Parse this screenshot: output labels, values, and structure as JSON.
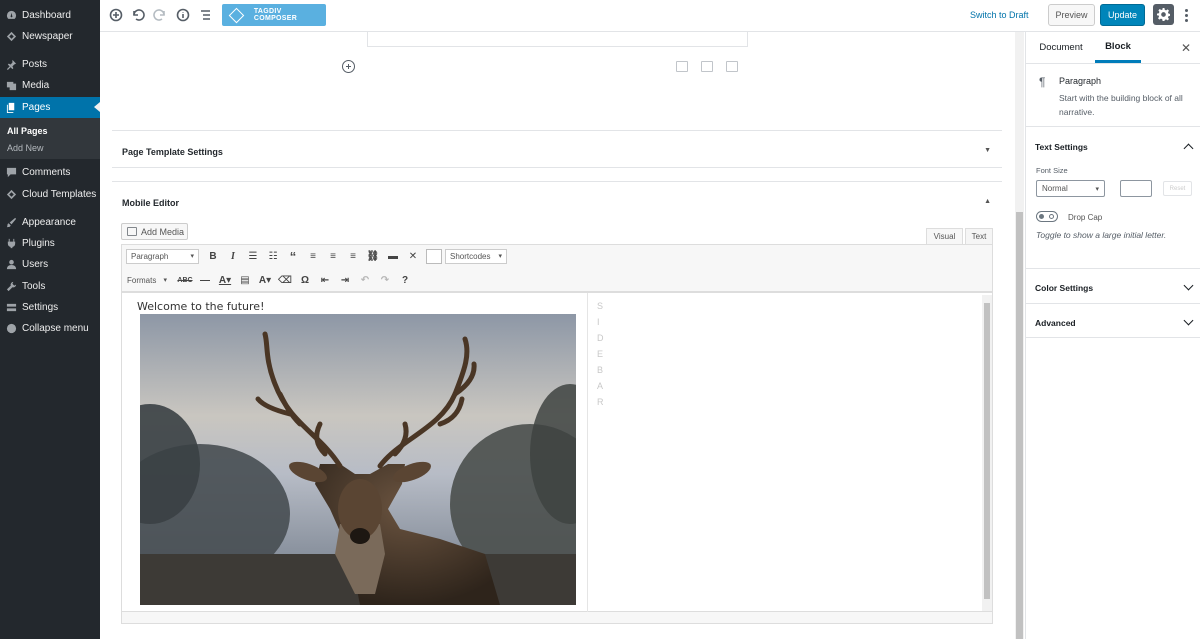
{
  "admin_menu": {
    "items": [
      {
        "label": "Dashboard",
        "icon": "dashboard-icon"
      },
      {
        "label": "Newspaper",
        "icon": "newspaper-icon"
      },
      {
        "label": "Posts",
        "icon": "pin-icon"
      },
      {
        "label": "Media",
        "icon": "media-icon"
      },
      {
        "label": "Pages",
        "icon": "pages-icon",
        "active": true
      },
      {
        "label": "Comments",
        "icon": "comments-icon"
      },
      {
        "label": "Cloud Templates",
        "icon": "cloud-icon"
      },
      {
        "label": "Appearance",
        "icon": "brush-icon"
      },
      {
        "label": "Plugins",
        "icon": "plugin-icon"
      },
      {
        "label": "Users",
        "icon": "users-icon"
      },
      {
        "label": "Tools",
        "icon": "wrench-icon"
      },
      {
        "label": "Settings",
        "icon": "settings-icon"
      },
      {
        "label": "Collapse menu",
        "icon": "collapse-icon"
      }
    ],
    "submenu": {
      "current": "All Pages",
      "other": "Add New"
    }
  },
  "topbar": {
    "tagdiv_label": "TAGDIV COMPOSER",
    "switch_draft": "Switch to Draft",
    "preview": "Preview",
    "update": "Update"
  },
  "content": {
    "page_template_title": "Page Template Settings",
    "page_template_toggle": "▼",
    "mobile_editor_title": "Mobile Editor",
    "mobile_editor_toggle": "▲",
    "add_media": "Add Media",
    "tab_visual": "Visual",
    "tab_text": "Text",
    "format_select": "Paragraph",
    "shortcodes_select": "Shortcodes",
    "formats_select": "Formats",
    "welcome_text": "Welcome to the future!",
    "sidebar_letters": [
      "S",
      "I",
      "D",
      "E",
      "B",
      "A",
      "R"
    ]
  },
  "settings_panel": {
    "tab_document": "Document",
    "tab_block": "Block",
    "close": "✕",
    "block_icon": "¶",
    "block_name": "Paragraph",
    "block_desc": "Start with the building block of all narrative.",
    "text_settings": "Text Settings",
    "font_size_label": "Font Size",
    "font_size_value": "Normal",
    "reset": "Reset",
    "drop_cap_label": "Drop Cap",
    "drop_cap_help": "Toggle to show a large initial letter.",
    "color_settings": "Color Settings",
    "advanced": "Advanced"
  },
  "colors": {
    "admin_bg": "#23282d",
    "accent": "#0073aa",
    "update_blue": "#0085ba",
    "tagdiv_blue": "#5ab0e0"
  }
}
